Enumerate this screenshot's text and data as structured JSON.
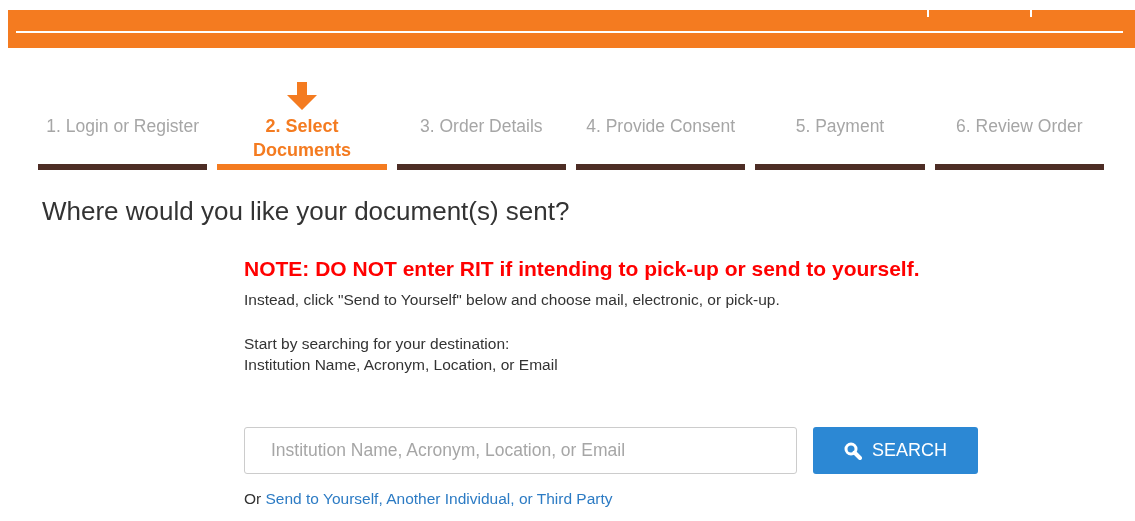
{
  "steps": [
    {
      "label": "1. Login or Register",
      "selected": false
    },
    {
      "label": "2. Select Documents",
      "selected": true
    },
    {
      "label": "3. Order Details",
      "selected": false
    },
    {
      "label": "4. Provide Consent",
      "selected": false
    },
    {
      "label": "5. Payment",
      "selected": false
    },
    {
      "label": "6. Review Order",
      "selected": false
    }
  ],
  "heading": "Where would you like your document(s) sent?",
  "note": "NOTE: DO NOT enter RIT if intending to pick-up or send to yourself.",
  "instead": "Instead, click \"Send to Yourself\" below and choose mail, electronic, or pick-up.",
  "instructions": [
    "Start by searching for your destination:",
    "Institution Name, Acronym, Location, or Email"
  ],
  "search": {
    "placeholder": "Institution Name, Acronym, Location, or Email",
    "button": "SEARCH"
  },
  "alternative": {
    "prefix": "Or",
    "link": "Send to Yourself, Another Individual, or Third Party"
  }
}
